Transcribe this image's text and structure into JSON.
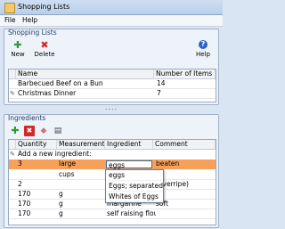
{
  "window": {
    "title": "Shopping Lists"
  },
  "menu": {
    "file": "File",
    "help": "Help"
  },
  "lists_panel": {
    "title": "Shopping Lists",
    "toolbar": {
      "new": "New",
      "delete": "Delete",
      "help": "Help"
    },
    "columns": {
      "name": "Name",
      "count": "Number of Items"
    },
    "rows": [
      {
        "name": "Barbecued Beef on a Bun",
        "count": "14"
      },
      {
        "name": "Christmas Dinner",
        "count": "7"
      }
    ]
  },
  "splitter": "....",
  "ingredients_panel": {
    "title": "Ingredients",
    "columns": {
      "quantity": "Quantity",
      "measurement": "Measurement",
      "ingredient": "Ingredient",
      "comment": "Comment"
    },
    "add_row_label": "Add a new ingredient:",
    "edit_row": {
      "quantity": "3",
      "measurement": "large",
      "ingredient": "eggs",
      "comment": "beaten"
    },
    "rows": [
      {
        "quantity": "",
        "measurement": "cups",
        "ingredient": "",
        "comment": ""
      },
      {
        "quantity": "2",
        "measurement": "",
        "ingredient": "",
        "comment": "(overripe)"
      },
      {
        "quantity": "170",
        "measurement": "g",
        "ingredient": "",
        "comment": ""
      },
      {
        "quantity": "170",
        "measurement": "g",
        "ingredient": "margarine",
        "comment": "soft"
      },
      {
        "quantity": "170",
        "measurement": "g",
        "ingredient": "self raising flour",
        "comment": ""
      }
    ],
    "autocomplete": [
      "eggs",
      "Eggs; separated",
      "Whites of Eggs"
    ]
  },
  "colors": {
    "selected_row": "#f7a05a",
    "new_icon": "#2e9b2e",
    "delete_icon": "#d02a2a",
    "help_icon": "#2a62c9"
  },
  "icons": {
    "new": "plus-icon",
    "delete": "x-icon",
    "help": "question-icon",
    "erase": "eraser-icon",
    "print": "printer-icon",
    "edit": "pencil-icon"
  }
}
